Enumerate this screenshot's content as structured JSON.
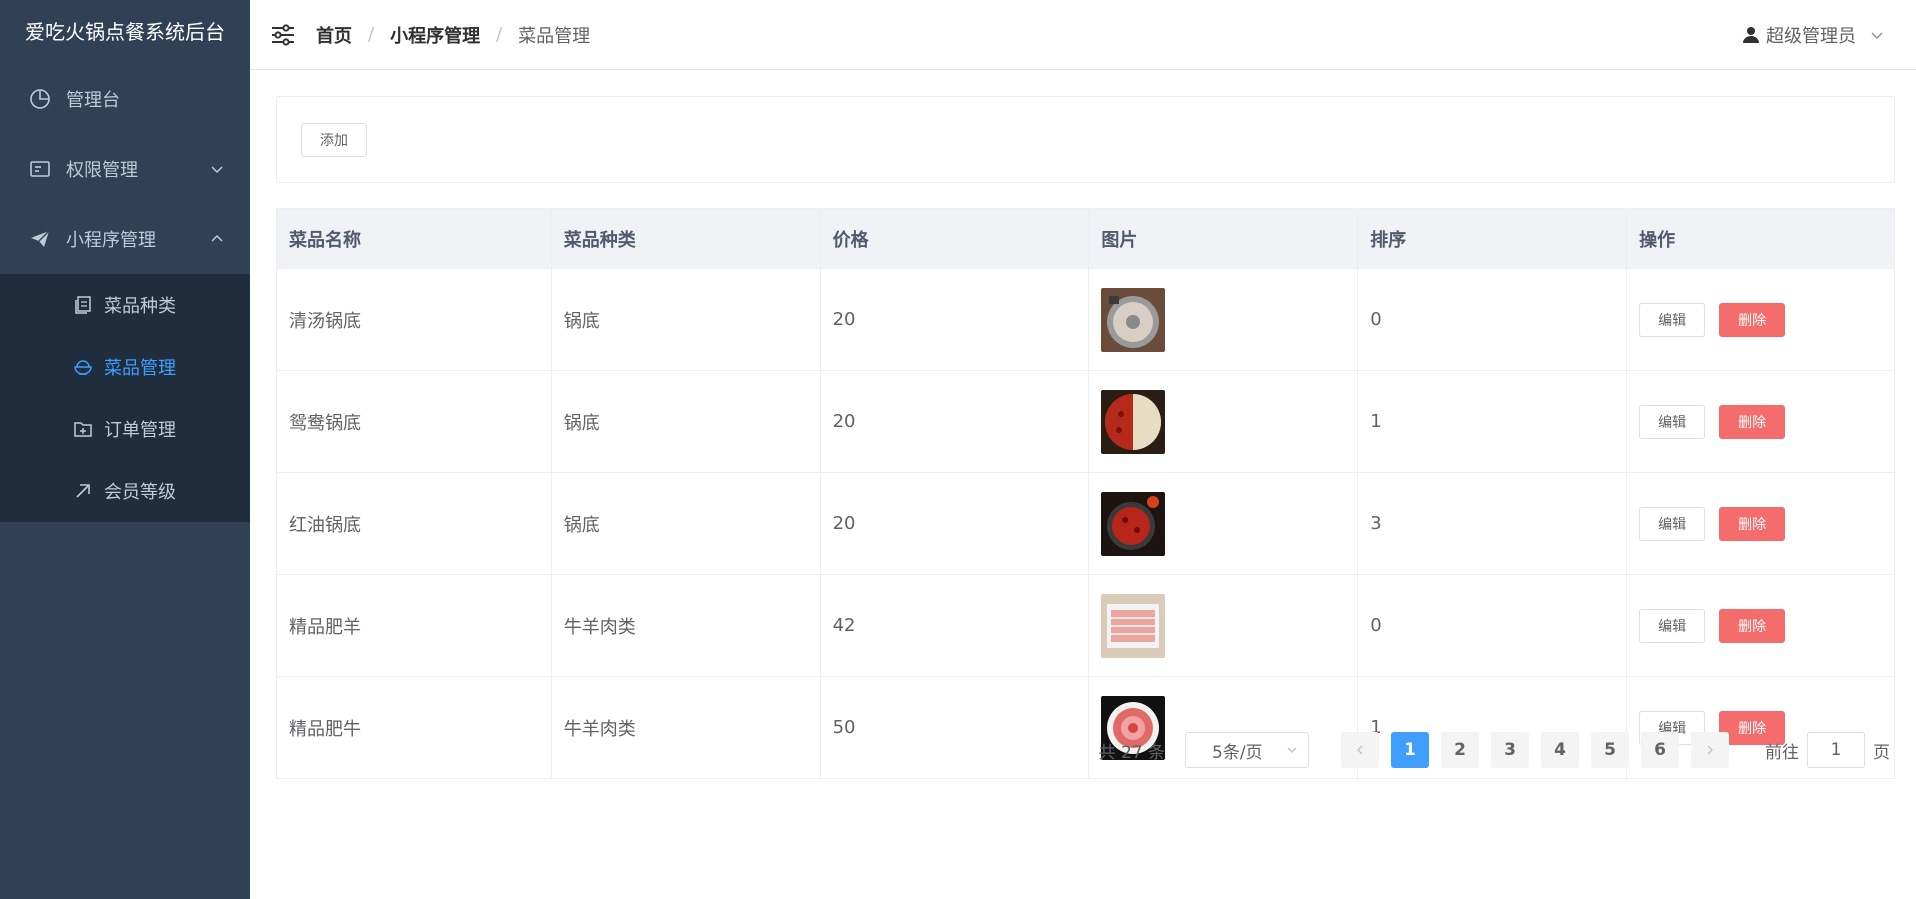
{
  "app": {
    "title": "爱吃火锅点餐系统后台"
  },
  "sidebar": {
    "items": [
      {
        "label": "管理台",
        "icon": "dashboard-icon"
      },
      {
        "label": "权限管理",
        "icon": "id-card-icon"
      },
      {
        "label": "小程序管理",
        "icon": "paper-plane-icon"
      }
    ],
    "subitems": [
      {
        "label": "菜品种类",
        "icon": "copy-icon"
      },
      {
        "label": "菜品管理",
        "icon": "bowl-icon"
      },
      {
        "label": "订单管理",
        "icon": "folder-add-icon"
      },
      {
        "label": "会员等级",
        "icon": "arrow-up-right-icon"
      }
    ],
    "active_sub": "菜品管理"
  },
  "header": {
    "breadcrumb": [
      "首页",
      "小程序管理",
      "菜品管理"
    ],
    "separator": "/",
    "user": "超级管理员"
  },
  "toolbar": {
    "add_label": "添加"
  },
  "table": {
    "columns": [
      "菜品名称",
      "菜品种类",
      "价格",
      "图片",
      "排序",
      "操作"
    ],
    "rows": [
      {
        "name": "清汤锅底",
        "category": "锅底",
        "price": "20",
        "image": "clear-broth-image",
        "sort": "0"
      },
      {
        "name": "鸳鸯锅底",
        "category": "锅底",
        "price": "20",
        "image": "yuanyang-broth-image",
        "sort": "1"
      },
      {
        "name": "红油锅底",
        "category": "锅底",
        "price": "20",
        "image": "red-oil-broth-image",
        "sort": "3"
      },
      {
        "name": "精品肥羊",
        "category": "牛羊肉类",
        "price": "42",
        "image": "lamb-slices-image",
        "sort": "0"
      },
      {
        "name": "精品肥牛",
        "category": "牛羊肉类",
        "price": "50",
        "image": "beef-slices-image",
        "sort": "1"
      }
    ],
    "edit_label": "编辑",
    "delete_label": "删除"
  },
  "pagination": {
    "total_text": "共 27 条",
    "page_size": "5条/页",
    "pages": [
      "1",
      "2",
      "3",
      "4",
      "5",
      "6"
    ],
    "current": "1",
    "goto_prefix": "前往",
    "goto_value": "1",
    "goto_suffix": "页"
  },
  "colors": {
    "sidebar": "#304156",
    "submenu": "#1f2d3d",
    "accent": "#409eff",
    "danger": "#f56c6c"
  }
}
